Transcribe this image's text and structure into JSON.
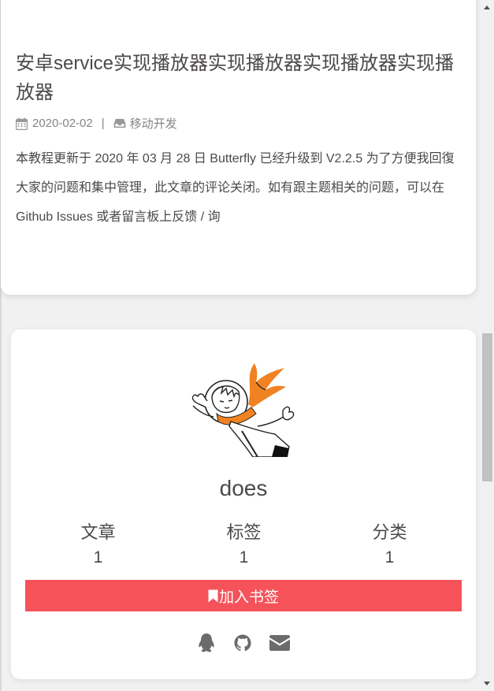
{
  "post": {
    "title": "安卓service实现播放器实现播放器实现播放器实现播放器",
    "date": "2020-02-02",
    "separator": "|",
    "category": "移动开发",
    "excerpt": "本教程更新于 2020 年 03 月 28 日 Butterfly 已经升级到 V2.2.5 为了方便我回復大家的问题和集中管理，此文章的评论关闭。如有跟主题相关的问题，可以在 Github Issues 或者留言板上反馈 / 询"
  },
  "author": {
    "name": "does",
    "stats": [
      {
        "label": "文章",
        "value": "1"
      },
      {
        "label": "标签",
        "value": "1"
      },
      {
        "label": "分类",
        "value": "1"
      }
    ],
    "bookmark_label": "加入书签",
    "accent_color": "#f5525a",
    "social_icons": [
      "qq-icon",
      "github-icon",
      "email-icon"
    ]
  }
}
